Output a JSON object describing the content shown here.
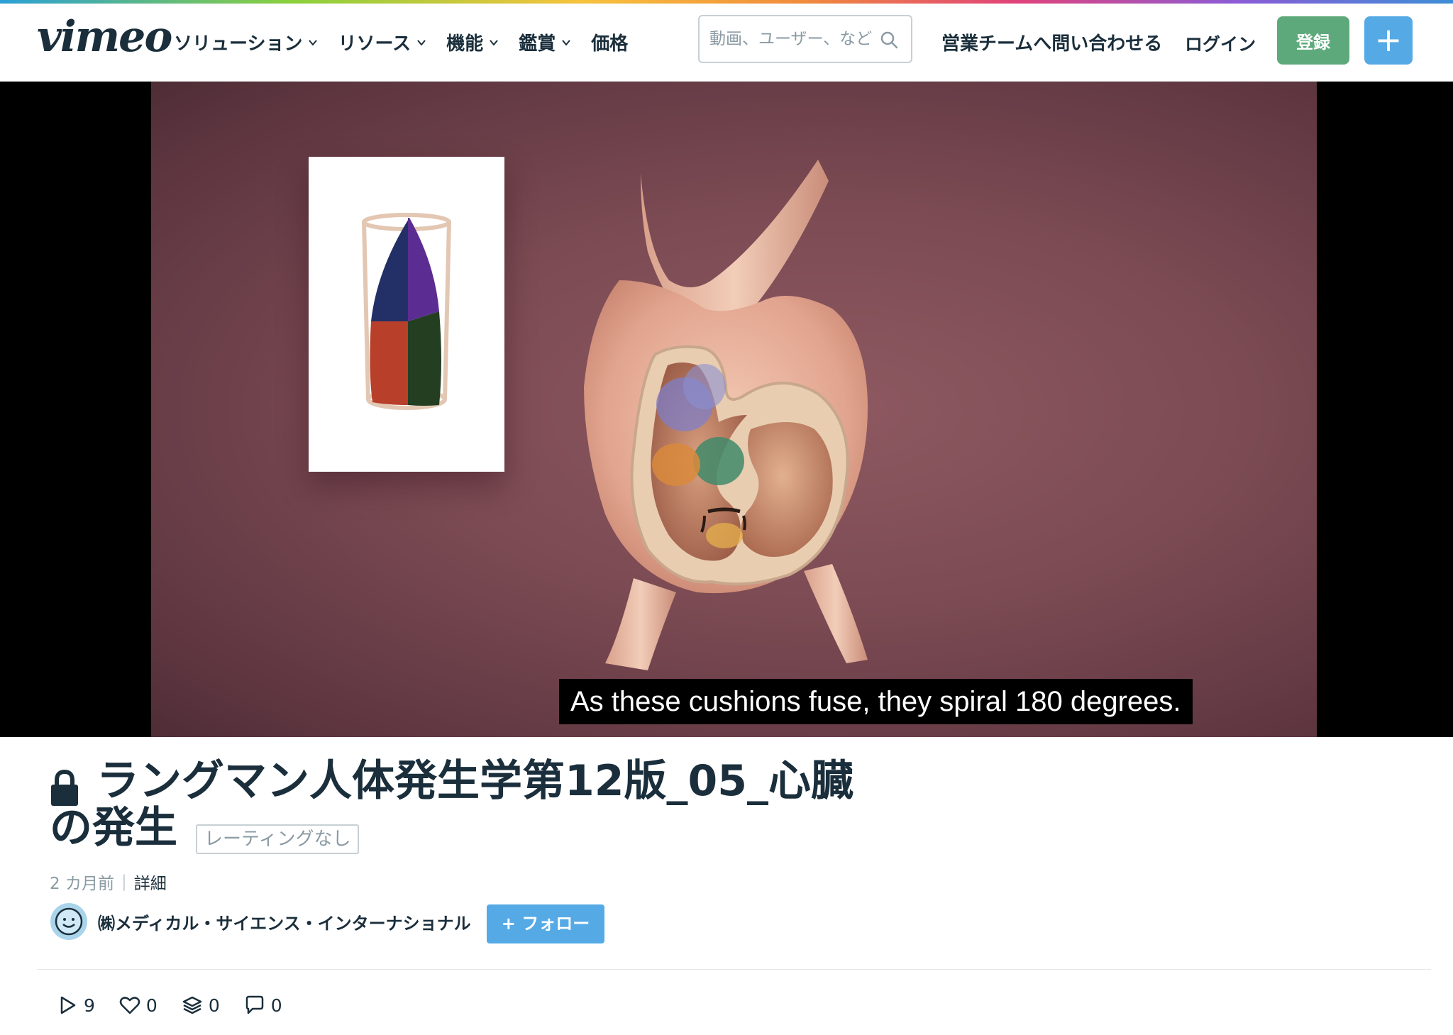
{
  "header": {
    "logo": "vimeo",
    "nav": [
      {
        "label": "ソリューション",
        "has_dropdown": true
      },
      {
        "label": "リソース",
        "has_dropdown": true
      },
      {
        "label": "機能",
        "has_dropdown": true
      },
      {
        "label": "鑑賞",
        "has_dropdown": true
      },
      {
        "label": "価格",
        "has_dropdown": false
      }
    ],
    "search_placeholder": "動画、ユーザー、など",
    "contact_sales": "営業チームへ問い合わせる",
    "login": "ログイン",
    "register": "登録",
    "upload_icon": "plus-icon"
  },
  "player": {
    "caption": "As these cushions fuse, they spiral 180 degrees."
  },
  "video": {
    "title": "ラングマン人体発生学第12版_05_心臓の発生",
    "rating": "レーティングなし",
    "age": "2 カ月前",
    "details": "詳細"
  },
  "channel": {
    "name": "㈱メディカル・サイエンス・インターナショナル",
    "follow": "+ フォロー"
  },
  "stats": {
    "plays": "9",
    "likes": "0",
    "collections": "0",
    "comments": "0"
  },
  "colors": {
    "accent_blue": "#55aae6",
    "register_green": "#5ea97b",
    "text_dark": "#1a2e3b",
    "muted": "#8a9aa3"
  }
}
